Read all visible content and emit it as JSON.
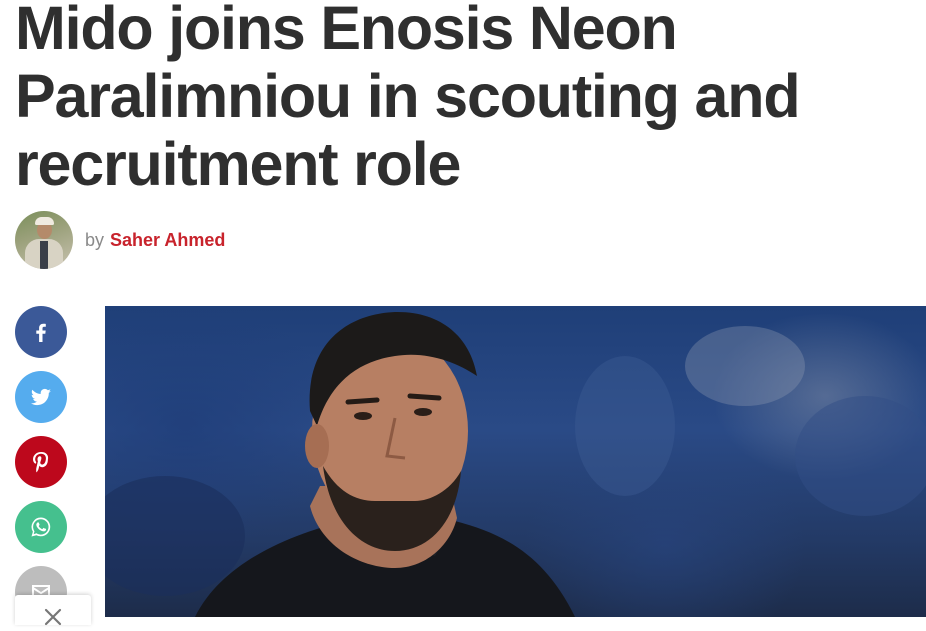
{
  "article": {
    "title": "Mido joins Enosis Neon Paralimniou in scouting and recruitment role",
    "byline_prefix": "by",
    "author": "Saher Ahmed"
  },
  "share": {
    "buttons": [
      {
        "icon": "facebook-icon",
        "color": "#3b5998"
      },
      {
        "icon": "twitter-icon",
        "color": "#55acee"
      },
      {
        "icon": "pinterest-icon",
        "color": "#bd081c"
      },
      {
        "icon": "whatsapp-icon",
        "color": "#45c08e"
      },
      {
        "icon": "email-icon",
        "color": "#bdbdbd"
      }
    ],
    "close_icon": "close-icon"
  },
  "colors": {
    "headline": "#2f2f2f",
    "author_link": "#c8232c",
    "byline_text": "#8a8a8a"
  }
}
